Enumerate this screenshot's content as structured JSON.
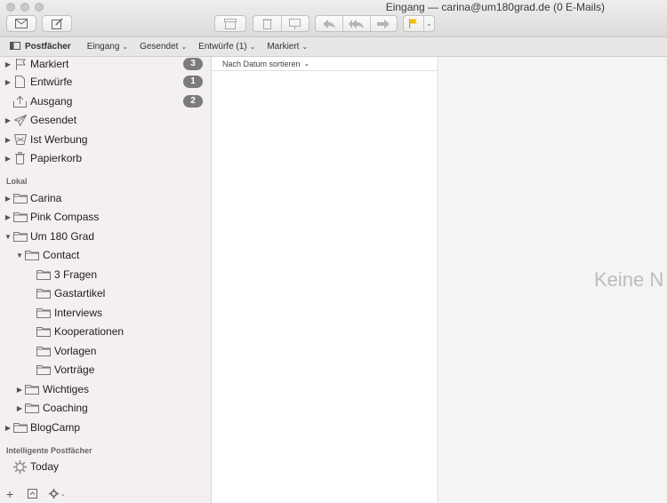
{
  "window": {
    "title": "Eingang — carina@um180grad.de (0 E-Mails)"
  },
  "toolbar": {
    "icons": [
      "new-message-icon",
      "compose-icon",
      "archive-icon",
      "trash-icon",
      "junk-icon",
      "reply-icon",
      "reply-all-icon",
      "forward-icon",
      "flag-icon"
    ]
  },
  "favorites": {
    "mailboxes_label": "Postfächer",
    "items": [
      {
        "label": "Eingang"
      },
      {
        "label": "Gesendet"
      },
      {
        "label": "Entwürfe (1)"
      },
      {
        "label": "Markiert"
      }
    ]
  },
  "sidebar": {
    "mailboxes": [
      {
        "label": "Markiert",
        "icon": "flag-icon",
        "badge": "3"
      },
      {
        "label": "Entwürfe",
        "icon": "document-icon",
        "badge": "1"
      },
      {
        "label": "Ausgang",
        "icon": "outbox-icon",
        "badge": "2"
      },
      {
        "label": "Gesendet",
        "icon": "paper-plane-icon",
        "badge": ""
      },
      {
        "label": "Ist Werbung",
        "icon": "junk-tray-icon",
        "badge": ""
      },
      {
        "label": "Papierkorb",
        "icon": "trash-icon",
        "badge": ""
      }
    ],
    "local_header": "Lokal",
    "local": [
      {
        "label": "Carina"
      },
      {
        "label": "Pink Compass"
      },
      {
        "label": "Um 180 Grad"
      },
      {
        "label": "Contact"
      },
      {
        "label": "3 Fragen"
      },
      {
        "label": "Gastartikel"
      },
      {
        "label": "Interviews"
      },
      {
        "label": "Kooperationen"
      },
      {
        "label": "Vorlagen"
      },
      {
        "label": "Vorträge"
      },
      {
        "label": "Wichtiges"
      },
      {
        "label": "Coaching"
      },
      {
        "label": "BlogCamp"
      }
    ],
    "smart_header": "Intelligente Postfächer",
    "smart": [
      {
        "label": "Today",
        "icon": "smart-mailbox-gear-icon"
      }
    ],
    "bottom_icons": [
      "add-icon",
      "toggle-icon",
      "gear-icon"
    ]
  },
  "message_list": {
    "sort_label": "Nach Datum sortieren"
  },
  "preview": {
    "empty_text": "Keine N"
  },
  "colors": {
    "sidebar_bg": "#f4eff1",
    "badge_bg": "#7c7b7b",
    "flag_accent": "#f5b800"
  }
}
